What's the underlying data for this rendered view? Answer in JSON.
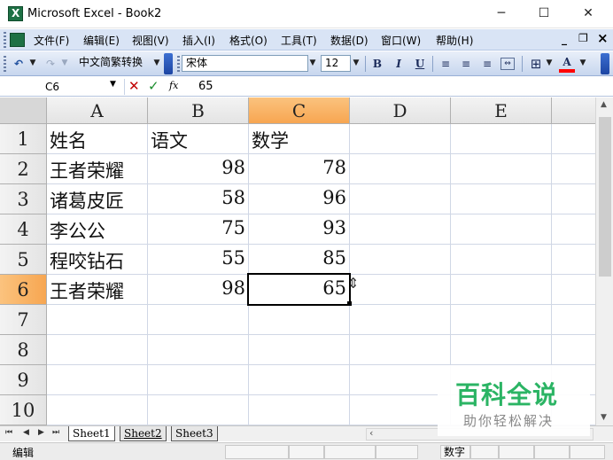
{
  "window": {
    "title": "Microsoft Excel - Book2",
    "controls": {
      "minimize": "─",
      "maximize": "☐",
      "close": "✕"
    }
  },
  "menubar": {
    "items": [
      "文件(F)",
      "编辑(E)",
      "视图(V)",
      "插入(I)",
      "格式(O)",
      "工具(T)",
      "数据(D)",
      "窗口(W)",
      "帮助(H)"
    ],
    "workbook_controls": {
      "minimize": "_",
      "restore": "❐",
      "close": "×"
    }
  },
  "toolbar": {
    "conversion_label": "中文简繁转换",
    "font_name": "宋体",
    "font_size": "12",
    "bold": "B",
    "italic": "I",
    "underline": "U",
    "font_color": "A",
    "font_color_hex": "#ff0000"
  },
  "formula_bar": {
    "name_box": "C6",
    "cancel": "✕",
    "enter": "✓",
    "fx": "fx",
    "value": "65"
  },
  "sheet": {
    "columns": [
      "A",
      "B",
      "C",
      "D",
      "E"
    ],
    "rows": [
      "1",
      "2",
      "3",
      "4",
      "5",
      "6",
      "7",
      "8",
      "9",
      "10"
    ],
    "active_cell": "C6",
    "selected_col": "C",
    "selected_row": "6",
    "highlight_color": "#f7a651",
    "cells": {
      "a1": "姓名",
      "b1": "语文",
      "c1": "数学",
      "a2": "王者荣耀",
      "b2": "98",
      "c2": "78",
      "a3": "诸葛皮匠",
      "b3": "58",
      "c3": "96",
      "a4": "李公公",
      "b4": "75",
      "c4": "93",
      "a5": "程咬钻石",
      "b5": "55",
      "c5": "85",
      "a6": "王者荣耀",
      "b6": "98",
      "c6": "65"
    }
  },
  "sheet_tabs": {
    "nav": [
      "⏮",
      "◀",
      "▶",
      "⏭"
    ],
    "tabs": [
      "Sheet1",
      "Sheet2",
      "Sheet3"
    ],
    "active": "Sheet1"
  },
  "statusbar": {
    "mode": "编辑",
    "numlock": "数字"
  },
  "watermark": {
    "title": "百科全说",
    "subtitle": "助你轻松解决",
    "color": "#2bb464"
  }
}
